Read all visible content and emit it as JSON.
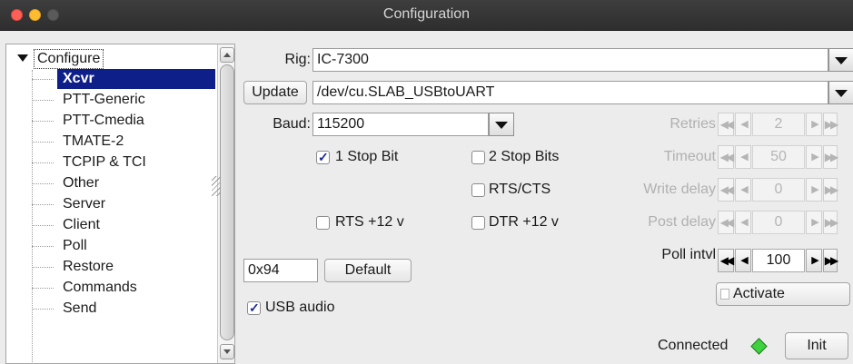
{
  "window": {
    "title": "Configuration"
  },
  "tree": {
    "root": "Configure",
    "items": [
      "Xcvr",
      "PTT-Generic",
      "PTT-Cmedia",
      "TMATE-2",
      "TCPIP & TCI",
      "Other",
      "Server",
      "Client",
      "Poll",
      "Restore",
      "Commands",
      "Send"
    ],
    "selected": "Xcvr"
  },
  "rig": {
    "label": "Rig:",
    "value": "IC-7300"
  },
  "port": {
    "update_label": "Update",
    "value": "/dev/cu.SLAB_USBtoUART"
  },
  "baud": {
    "label": "Baud:",
    "value": "115200"
  },
  "checks": {
    "stop1": {
      "label": "1 Stop Bit",
      "checked": true
    },
    "stop2": {
      "label": "2 Stop Bits",
      "checked": false
    },
    "rtscts": {
      "label": "RTS/CTS",
      "checked": false
    },
    "rts12": {
      "label": "RTS +12 v",
      "checked": false
    },
    "dtr12": {
      "label": "DTR +12 v",
      "checked": false
    },
    "usb_audio": {
      "label": "USB audio",
      "checked": true
    }
  },
  "spinners": {
    "retries": {
      "label": "Retries",
      "value": "2",
      "enabled": false
    },
    "timeout": {
      "label": "Timeout",
      "value": "50",
      "enabled": false
    },
    "write_delay": {
      "label": "Write delay",
      "value": "0",
      "enabled": false
    },
    "post_delay": {
      "label": "Post delay",
      "value": "0",
      "enabled": false
    },
    "poll_intvl": {
      "label": "Poll intvl",
      "value": "100",
      "enabled": true
    }
  },
  "civ": {
    "value": "0x94",
    "default_label": "Default"
  },
  "activate": {
    "label": "Activate",
    "checked": false
  },
  "status": {
    "label": "Connected",
    "indicator_color": "#3fd13f",
    "init_label": "Init"
  }
}
